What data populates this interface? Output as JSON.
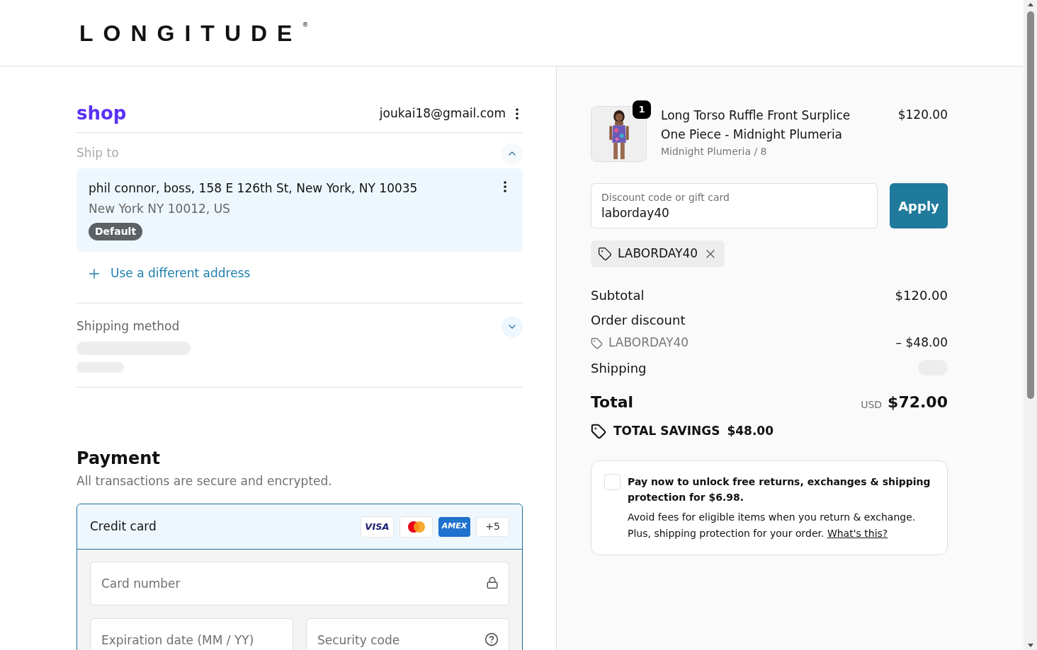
{
  "header": {
    "logo": "LONGITUDE",
    "logo_mark": "®"
  },
  "account": {
    "brand": "shop",
    "email": "joukai18@gmail.com"
  },
  "ship_to": {
    "title": "Ship to",
    "expanded": true,
    "address": {
      "line1": "phil connor, boss, 158 E 126th St, New York, NY 10035",
      "line2": "New York NY 10012, US",
      "badge": "Default"
    },
    "add_link": "Use a different address"
  },
  "shipping_method": {
    "title": "Shipping method",
    "expanded": false
  },
  "payment": {
    "title": "Payment",
    "subtitle": "All transactions are secure and encrypted.",
    "method": {
      "label": "Credit card",
      "selected": true,
      "brands": [
        {
          "kind": "visa",
          "text": "VISA"
        },
        {
          "kind": "mastercard"
        },
        {
          "kind": "amex",
          "text": "AMEX"
        },
        {
          "kind": "more",
          "text": "+5"
        }
      ]
    },
    "fields": [
      {
        "kind": "card_number",
        "placeholder": "Card number"
      },
      {
        "kind": "expiry",
        "placeholder": "Expiration date (MM / YY)"
      },
      {
        "kind": "security_code",
        "placeholder": "Security code"
      }
    ]
  },
  "summary": {
    "item": {
      "quantity": "1",
      "name": "Long Torso Ruffle Front Surplice One Piece - Midnight Plumeria",
      "variant": "Midnight Plumeria / 8",
      "price": "$120.00"
    },
    "discount_field": {
      "placeholder": "Discount code or gift card",
      "value": "laborday40"
    },
    "apply_button": "Apply",
    "applied_code": "LABORDAY40",
    "rows": [
      {
        "kind": "line",
        "label": "Subtotal",
        "value": "$120.00"
      },
      {
        "kind": "heading",
        "label": "Order discount"
      },
      {
        "kind": "code",
        "label": "LABORDAY40",
        "value": "– $48.00"
      },
      {
        "kind": "loading",
        "label": "Shipping"
      }
    ],
    "total": {
      "label": "Total",
      "currency": "USD",
      "value": "$72.00"
    },
    "savings": {
      "label": "TOTAL SAVINGS",
      "value": "$48.00"
    },
    "protection": {
      "checked": false,
      "title": "Pay now to unlock free returns, exchanges & shipping protection for $6.98.",
      "body": "Avoid fees for eligible items when you return & exchange. Plus, shipping protection for your order.",
      "link": "What's this?"
    }
  }
}
